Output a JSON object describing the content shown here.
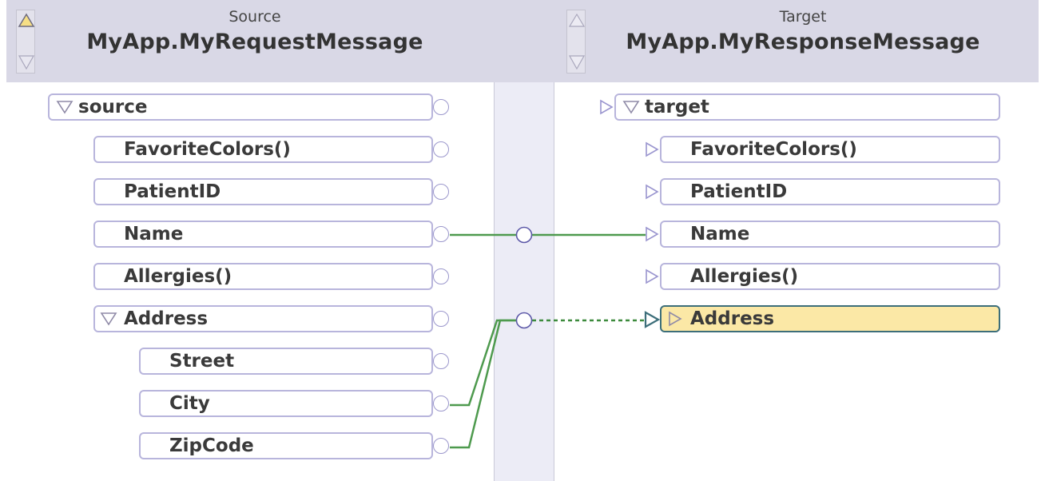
{
  "source_pane": {
    "caption": "Source",
    "title": "MyApp.MyRequestMessage",
    "tree": [
      {
        "label": "source",
        "expanded": true
      },
      {
        "label": "FavoriteColors()"
      },
      {
        "label": "PatientID"
      },
      {
        "label": "Name"
      },
      {
        "label": "Allergies()"
      },
      {
        "label": "Address",
        "expanded": true
      },
      {
        "label": "Street"
      },
      {
        "label": "City"
      },
      {
        "label": "ZipCode"
      }
    ]
  },
  "target_pane": {
    "caption": "Target",
    "title": "MyApp.MyResponseMessage",
    "tree": [
      {
        "label": "target",
        "expanded": true
      },
      {
        "label": "FavoriteColors()"
      },
      {
        "label": "PatientID"
      },
      {
        "label": "Name"
      },
      {
        "label": "Allergies()"
      },
      {
        "label": "Address",
        "expanded": false,
        "selected": true
      }
    ]
  },
  "connections": [
    {
      "from": "Name",
      "to": "Name",
      "style": "solid"
    },
    {
      "from": [
        "City",
        "ZipCode"
      ],
      "to": "Address",
      "style": "dashed"
    }
  ],
  "colors": {
    "header_bg": "#d9d8e6",
    "node_border": "#b8b5dc",
    "selected_bg": "#fbe8a6",
    "link_green": "#4e9a4e",
    "scroll_up_active": "#f6df86"
  },
  "icons": {
    "expand": "triangle-down-icon",
    "collapsed": "triangle-right-icon",
    "connector": "circle-connector-icon",
    "scroll": "scroll-arrows-icon"
  }
}
